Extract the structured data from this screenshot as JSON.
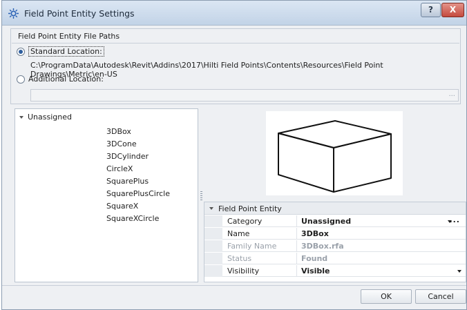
{
  "window": {
    "title": "Field Point Entity Settings",
    "help_label": "?",
    "close_label": "X"
  },
  "file_paths": {
    "group_title": "Field Point Entity File Paths",
    "standard_label": "Standard Location:",
    "standard_selected": true,
    "standard_path": "C:\\ProgramData\\Autodesk\\Revit\\Addins\\2017\\Hilti Field Points\\Contents\\Resources\\Field Point Drawings\\Metric\\en-US",
    "additional_label": "Additional Location:",
    "additional_path": "",
    "browse_label": "..."
  },
  "tree": {
    "root_label": "Unassigned",
    "items": [
      "3DBox",
      "3DCone",
      "3DCylinder",
      "CircleX",
      "SquarePlus",
      "SquarePlusCircle",
      "SquareX",
      "SquareXCircle"
    ]
  },
  "properties": {
    "header": "Field Point Entity",
    "rows": [
      {
        "name": "Category",
        "value": "Unassigned"
      },
      {
        "name": "Name",
        "value": "3DBox"
      },
      {
        "name": "Family Name",
        "value": "3DBox.rfa"
      },
      {
        "name": "Status",
        "value": "Found"
      },
      {
        "name": "Visibility",
        "value": "Visible"
      }
    ],
    "category_more": "..."
  },
  "footer": {
    "ok_label": "OK",
    "cancel_label": "Cancel"
  },
  "colors": {
    "accent": "#2f5f9e",
    "close": "#c44a3e"
  }
}
